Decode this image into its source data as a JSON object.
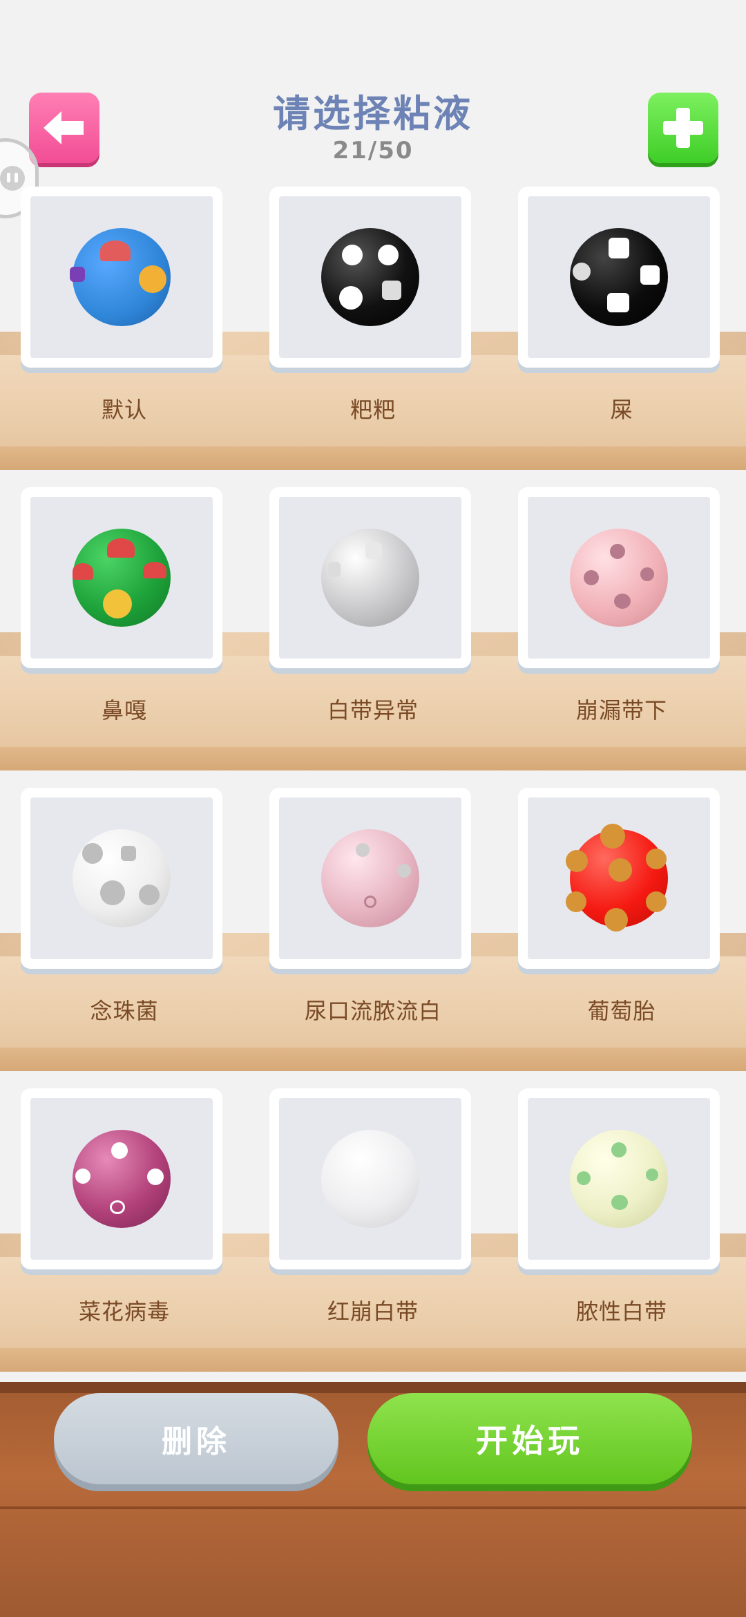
{
  "header": {
    "title": "请选择粘液",
    "counter": "21/50"
  },
  "icons": {
    "back": "left-arrow-icon",
    "add": "plus-icon",
    "float": "assistive-touch-icon"
  },
  "colors": {
    "back_button": "#f24d95",
    "add_button": "#3fce27",
    "title": "#6d83b5",
    "label": "#7a4a26"
  },
  "slimes": [
    {
      "label": "默认",
      "ball": "#2f86d8",
      "nub": "#e25c5c"
    },
    {
      "label": "粑粑",
      "ball": "#111111",
      "nub": "#ffffff"
    },
    {
      "label": "屎",
      "ball": "#0c0c0c",
      "nub": "#ffffff"
    },
    {
      "label": "鼻嘎",
      "ball": "#1ea33a",
      "nub": "#e04848"
    },
    {
      "label": "白带异常",
      "ball": "#c9c9cb",
      "nub": "#e8e8e8"
    },
    {
      "label": "崩漏带下",
      "ball": "#f1b2b8",
      "nub": "#b77a8c"
    },
    {
      "label": "念珠菌",
      "ball": "#eeeeee",
      "nub": "#bdbdbd"
    },
    {
      "label": "尿口流脓流白",
      "ball": "#e7b5c2",
      "nub": "#cfcfcf"
    },
    {
      "label": "葡萄胎",
      "ball": "#f51a12",
      "nub": "#d69437"
    },
    {
      "label": "菜花病毒",
      "ball": "#b2427a",
      "nub": "#ffffff"
    },
    {
      "label": "红崩白带",
      "ball": "#eeeef0",
      "nub": "#ffffff"
    },
    {
      "label": "脓性白带",
      "ball": "#eef0c8",
      "nub": "#8fd08a"
    }
  ],
  "buttons": {
    "delete": "删除",
    "play": "开始玩"
  }
}
